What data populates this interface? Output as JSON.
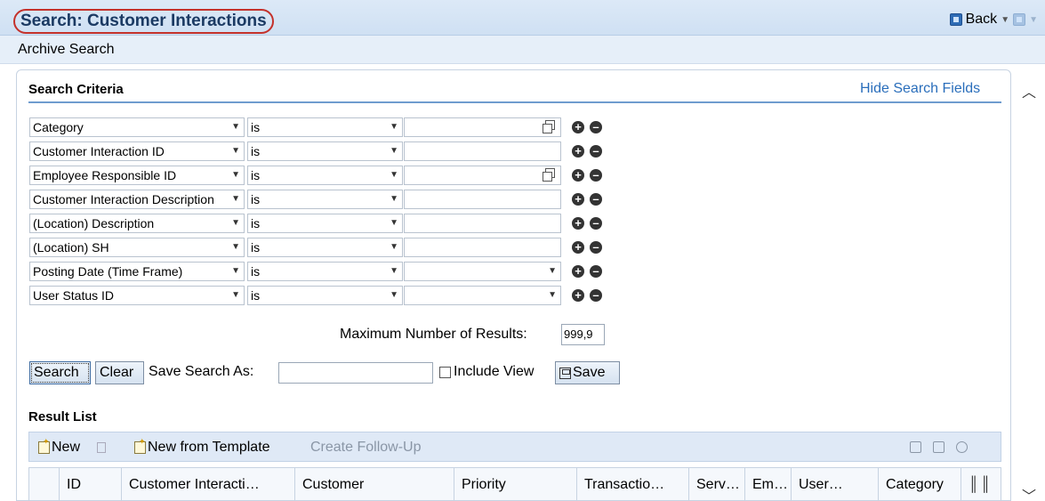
{
  "header": {
    "title": "Search: Customer Interactions",
    "back_label": "Back",
    "back_icon": "back-arrow-icon",
    "forward_icon": "forward-arrow-icon"
  },
  "subheader": {
    "title": "Archive Search"
  },
  "search_criteria": {
    "heading": "Search Criteria",
    "hide_link": "Hide Search Fields",
    "rows": [
      {
        "field": "Category",
        "operator": "is",
        "value": "",
        "value_type": "picker"
      },
      {
        "field": "Customer Interaction ID",
        "operator": "is",
        "value": "",
        "value_type": "text"
      },
      {
        "field": "Employee Responsible ID",
        "operator": "is",
        "value": "",
        "value_type": "picker"
      },
      {
        "field": "Customer Interaction Description",
        "operator": "is",
        "value": "",
        "value_type": "text"
      },
      {
        "field": "(Location) Description",
        "operator": "is",
        "value": "",
        "value_type": "text"
      },
      {
        "field": "(Location) SH",
        "operator": "is",
        "value": "",
        "value_type": "text"
      },
      {
        "field": "Posting Date (Time Frame)",
        "operator": "is",
        "value": "",
        "value_type": "dropdown"
      },
      {
        "field": "User Status ID",
        "operator": "is",
        "value": "",
        "value_type": "dropdown"
      }
    ],
    "max_results_label": "Maximum Number of Results:",
    "max_results_value": "999,9"
  },
  "actions": {
    "search_label": "Search",
    "clear_label": "Clear",
    "save_search_as_label": "Save Search As:",
    "save_search_as_value": "",
    "include_view_label": "Include View",
    "save_label": "Save"
  },
  "result_list": {
    "heading": "Result List",
    "toolbar": {
      "new_label": "New",
      "new_from_template_label": "New from Template",
      "create_follow_up_label": "Create Follow-Up"
    },
    "columns": [
      "ID",
      "Customer Interacti…",
      "Customer",
      "Priority",
      "Transactio…",
      "Serv…",
      "Em…",
      "User…",
      "Category"
    ]
  }
}
